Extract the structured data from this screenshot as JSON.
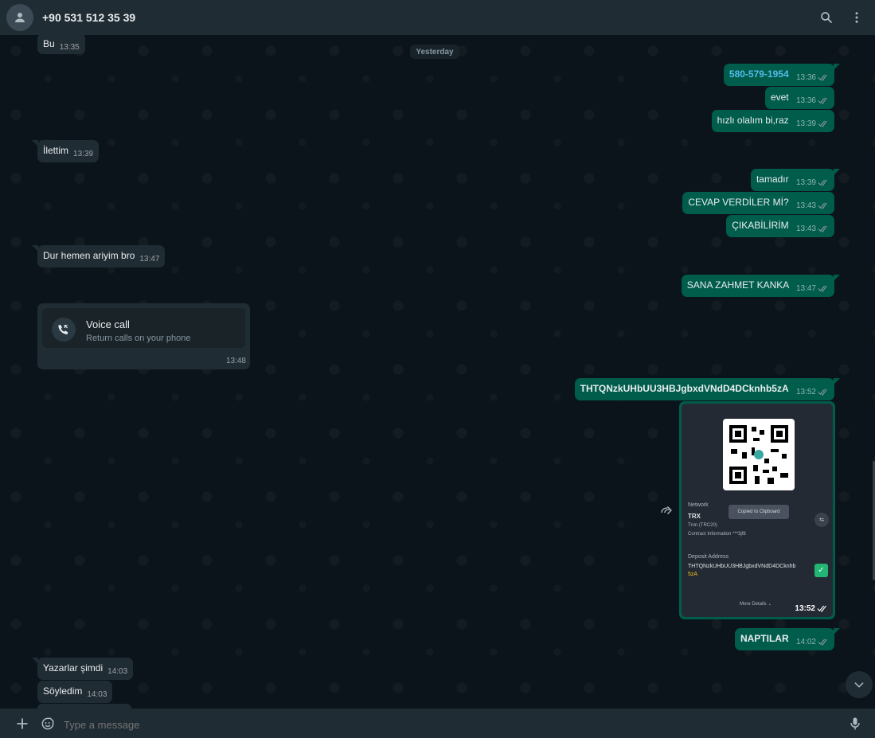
{
  "header": {
    "contact_name": "+90 531 512 35 39"
  },
  "date_chip": "Yesterday",
  "messages": {
    "m1": {
      "text": "Bu",
      "time": "13:35"
    },
    "m2": {
      "text": "580-579-1954",
      "time": "13:36"
    },
    "m3": {
      "text": "evet",
      "time": "13:36"
    },
    "m4": {
      "text": "hızlı olalım bi,raz",
      "time": "13:39"
    },
    "m5": {
      "text": "İlettim",
      "time": "13:39"
    },
    "m6": {
      "text": "tamadır",
      "time": "13:39"
    },
    "m7": {
      "text": "CEVAP VERDİLER Mİ?",
      "time": "13:43"
    },
    "m8": {
      "text": "ÇIKABİLİRİM",
      "time": "13:43"
    },
    "m9": {
      "text": "Dur hemen ariyim bro",
      "time": "13:47"
    },
    "m10": {
      "text": "SANA ZAHMET KANKA",
      "time": "13:47"
    },
    "m11": {
      "text": "THTQNzkUHbUU3HBJgbxdVNdD4DCknhb5zA",
      "time": "13:52"
    },
    "m12": {
      "text": "NAPTILAR",
      "time": "14:02"
    },
    "m13": {
      "text": "Yazarlar şimdi",
      "time": "14:03"
    },
    "m14": {
      "text": "Söyledim",
      "time": "14:03"
    }
  },
  "voice_call": {
    "title": "Voice call",
    "subtitle": "Return calls on your phone",
    "time": "13:48"
  },
  "image_message": {
    "time": "13:52",
    "network_label": "Network",
    "network_value": "TRX",
    "network_sub": "Tron (TRC20)",
    "contract_info": "Contract Information ***3jf8",
    "copied_toast": "Copied to Clipboard",
    "deposit_label": "Deposit Address",
    "deposit_address_line1": "THTQNzkUHbUU3HBJgbxdVNdD4DCknhb",
    "deposit_address_line2": "5zA",
    "more_details": "More Details ⌄"
  },
  "composer": {
    "placeholder": "Type a message"
  },
  "colors": {
    "outgoing": "#005c4b",
    "incoming": "#202c33",
    "background": "#0b141a",
    "header": "#202c33",
    "link": "#53bdeb"
  }
}
